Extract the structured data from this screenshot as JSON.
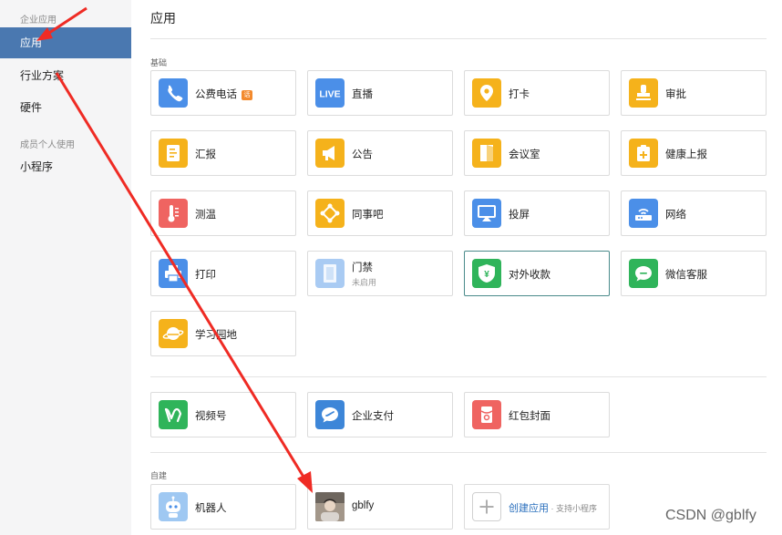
{
  "sidebar": {
    "group1": "企业应用",
    "items": [
      {
        "label": "应用"
      },
      {
        "label": "行业方案"
      },
      {
        "label": "硬件"
      }
    ],
    "group2": "成员个人使用",
    "items2": [
      {
        "label": "小程序"
      }
    ]
  },
  "main": {
    "title": "应用",
    "section_basic": "基础",
    "section_custom": "自建",
    "basic_apps": [
      {
        "name": "公费电话",
        "badge": "话",
        "icon": "phone-icon",
        "color": "#4b8fe8"
      },
      {
        "name": "直播",
        "icon": "live-icon",
        "color": "#4b8fe8"
      },
      {
        "name": "打卡",
        "icon": "location-pin-icon",
        "color": "#f5b21b"
      },
      {
        "name": "审批",
        "icon": "stamp-icon",
        "color": "#f5b21b"
      },
      {
        "name": "汇报",
        "icon": "report-icon",
        "color": "#f5b21b"
      },
      {
        "name": "公告",
        "icon": "megaphone-icon",
        "color": "#f5b21b"
      },
      {
        "name": "会议室",
        "icon": "door-icon",
        "color": "#f5b21b"
      },
      {
        "name": "健康上报",
        "icon": "health-clipboard-icon",
        "color": "#f5b21b"
      },
      {
        "name": "测温",
        "icon": "thermometer-icon",
        "color": "#ef6461"
      },
      {
        "name": "同事吧",
        "icon": "nodes-icon",
        "color": "#f5b21b"
      },
      {
        "name": "投屏",
        "icon": "screen-cast-icon",
        "color": "#4b8fe8"
      },
      {
        "name": "网络",
        "icon": "router-icon",
        "color": "#4b8fe8"
      },
      {
        "name": "打印",
        "icon": "printer-icon",
        "color": "#4b8fe8"
      },
      {
        "name": "门禁",
        "sub": "未启用",
        "icon": "door-access-icon",
        "color": "#a9cbf3"
      },
      {
        "name": "对外收款",
        "icon": "yuan-shield-icon",
        "color": "#2fb45a"
      },
      {
        "name": "微信客服",
        "icon": "chat-bubble-icon",
        "color": "#2fb45a"
      },
      {
        "name": "学习园地",
        "icon": "planet-icon",
        "color": "#f5b21b"
      }
    ],
    "extra_apps": [
      {
        "name": "视频号",
        "icon": "channels-icon",
        "color": "#2fb45a"
      },
      {
        "name": "企业支付",
        "icon": "payment-icon",
        "color": "#3d86d8"
      },
      {
        "name": "红包封面",
        "icon": "red-packet-icon",
        "color": "#ef6461"
      }
    ],
    "custom_apps": [
      {
        "name": "机器人",
        "icon": "robot-icon",
        "color": "#9fc8f2"
      },
      {
        "name": "gblfy",
        "icon": "user-photo-icon",
        "color": "#8a7f72"
      }
    ],
    "create": {
      "label": "创建应用",
      "sep": " · ",
      "hint": "支持小程序"
    }
  },
  "watermark": "CSDN @gblfy",
  "annotation_color": "#ef2b24"
}
